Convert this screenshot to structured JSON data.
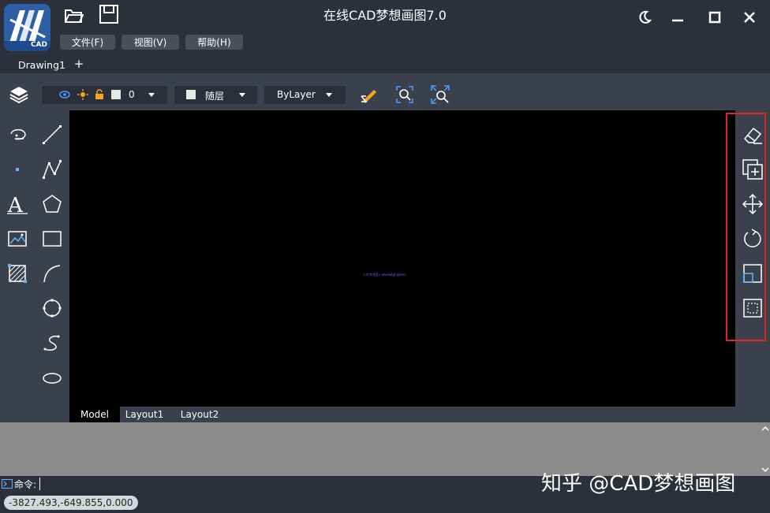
{
  "app": {
    "title": "在线CAD梦想画图7.0",
    "logo_text": "CAD"
  },
  "menu": [
    "文件(F)",
    "视图(V)",
    "帮助(H)"
  ],
  "tabs": {
    "document": "Drawing1",
    "add": "+"
  },
  "toolbar": {
    "layer_value": "0",
    "color_value": "随层",
    "linetype_value": "ByLayer"
  },
  "left_tools": [
    "arc-tool",
    "line-tool",
    "point-tool",
    "polyline-tool",
    "text-tool",
    "polygon-tool",
    "image-tool",
    "rectangle-tool",
    "hatch-tool",
    "curve-tool",
    "circle-tool",
    "spline-tool",
    "ellipse-tool"
  ],
  "right_tools": [
    "erase-tool",
    "copy-tool",
    "move-tool",
    "rotate-tool",
    "scale-tool",
    "select-tool"
  ],
  "canvas": {
    "center_text": "<文字内容>  abcdefghijklmn"
  },
  "layout_tabs": [
    "Model",
    "Layout1",
    "Layout2"
  ],
  "command": {
    "prompt": "命令:"
  },
  "status": {
    "coordinates": "-3827.493,-649.855,0.000"
  },
  "watermark": "知乎 @CAD梦想画图",
  "colors": {
    "background": "#2b303b",
    "toolbar": "#3a404c",
    "canvas": "#000000",
    "highlight_box": "#e02323",
    "accent_blue": "#3a74c4"
  }
}
